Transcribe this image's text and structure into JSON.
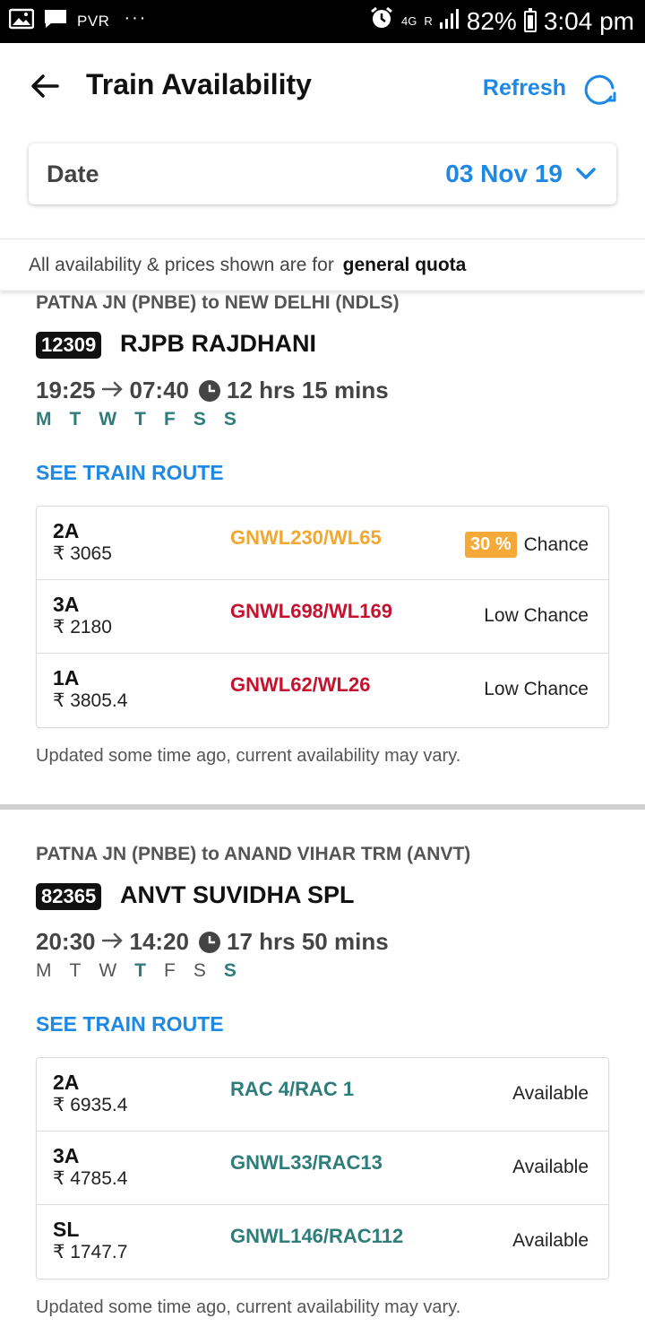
{
  "status_bar": {
    "carrier": "PVR",
    "dots": "···",
    "network": "4G",
    "roaming": "R",
    "battery": "82%",
    "time": "3:04 pm"
  },
  "header": {
    "title": "Train Availability",
    "refresh_label": "Refresh"
  },
  "date_card": {
    "label": "Date",
    "value": "03 Nov 19"
  },
  "quota": {
    "text": "All availability & prices shown are for",
    "bold": "general quota"
  },
  "trains": [
    {
      "route": "PATNA JN (PNBE) to NEW DELHI (NDLS)",
      "number": "12309",
      "name": "RJPB RAJDHANI",
      "depart": "19:25",
      "arrive": "07:40",
      "duration": "12 hrs 15 mins",
      "days": [
        {
          "label": "M",
          "on": true
        },
        {
          "label": "T",
          "on": true
        },
        {
          "label": "W",
          "on": true
        },
        {
          "label": "T",
          "on": true
        },
        {
          "label": "F",
          "on": true
        },
        {
          "label": "S",
          "on": true
        },
        {
          "label": "S",
          "on": true
        }
      ],
      "see_route": "SEE TRAIN ROUTE",
      "classes": [
        {
          "cls": "2A",
          "price": "₹ 3065",
          "status": "GNWL230/WL65",
          "status_color": "#f0a830",
          "badge": "30 %",
          "chance": "Chance"
        },
        {
          "cls": "3A",
          "price": "₹ 2180",
          "status": "GNWL698/WL169",
          "status_color": "#c4122f",
          "badge": "",
          "chance": "Low Chance"
        },
        {
          "cls": "1A",
          "price": "₹ 3805.4",
          "status": "GNWL62/WL26",
          "status_color": "#c4122f",
          "badge": "",
          "chance": "Low Chance"
        }
      ],
      "note": "Updated some time ago, current availability may vary."
    },
    {
      "route": "PATNA JN (PNBE) to ANAND VIHAR TRM (ANVT)",
      "number": "82365",
      "name": "ANVT SUVIDHA SPL",
      "depart": "20:30",
      "arrive": "14:20",
      "duration": "17 hrs 50 mins",
      "days": [
        {
          "label": "M",
          "on": false
        },
        {
          "label": "T",
          "on": false
        },
        {
          "label": "W",
          "on": false
        },
        {
          "label": "T",
          "on": true
        },
        {
          "label": "F",
          "on": false
        },
        {
          "label": "S",
          "on": false
        },
        {
          "label": "S",
          "on": true
        }
      ],
      "see_route": "SEE TRAIN ROUTE",
      "classes": [
        {
          "cls": "2A",
          "price": "₹ 6935.4",
          "status": "RAC 4/RAC 1",
          "status_color": "#2e7d7a",
          "badge": "",
          "chance": "Available"
        },
        {
          "cls": "3A",
          "price": "₹ 4785.4",
          "status": "GNWL33/RAC13",
          "status_color": "#2e7d7a",
          "badge": "",
          "chance": "Available"
        },
        {
          "cls": "SL",
          "price": "₹ 1747.7",
          "status": "GNWL146/RAC112",
          "status_color": "#2e7d7a",
          "badge": "",
          "chance": "Available"
        }
      ],
      "note": "Updated some time ago, current availability may vary."
    }
  ]
}
